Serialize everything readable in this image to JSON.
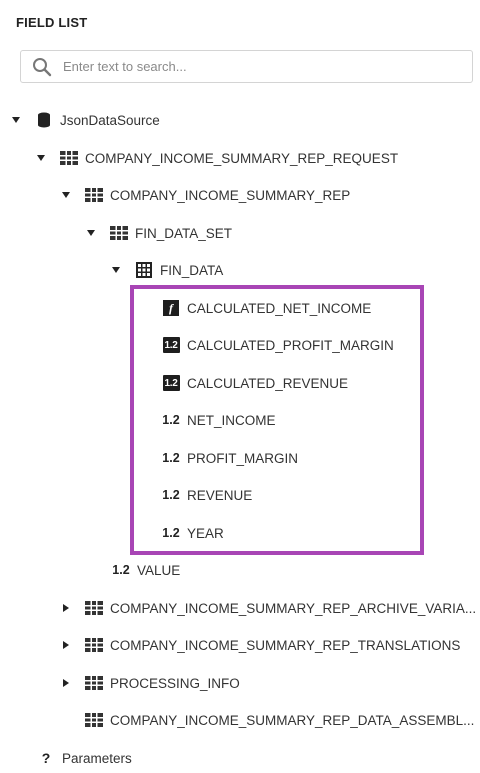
{
  "panel": {
    "title": "FIELD LIST"
  },
  "search": {
    "placeholder": "Enter text to search..."
  },
  "colors": {
    "highlight": "#a845b5",
    "icon_dark": "#1e1e1e"
  },
  "tree": {
    "datasource": {
      "label": "JsonDataSource",
      "icon": "database-icon"
    },
    "request": {
      "label": "COMPANY_INCOME_SUMMARY_REP_REQUEST",
      "icon": "table-icon"
    },
    "rep": {
      "label": "COMPANY_INCOME_SUMMARY_REP",
      "icon": "table-icon"
    },
    "fin_data_set": {
      "label": "FIN_DATA_SET",
      "icon": "table-icon"
    },
    "fin_data": {
      "label": "FIN_DATA",
      "icon": "grid-icon"
    },
    "fields": [
      {
        "label": "CALCULATED_NET_INCOME",
        "icon": "function-icon",
        "badge": "f"
      },
      {
        "label": "CALCULATED_PROFIT_MARGIN",
        "icon": "calculated-number-icon",
        "badge": "1.2"
      },
      {
        "label": "CALCULATED_REVENUE",
        "icon": "calculated-number-icon",
        "badge": "1.2"
      },
      {
        "label": "NET_INCOME",
        "icon": "number-icon",
        "badge": "1.2"
      },
      {
        "label": "PROFIT_MARGIN",
        "icon": "number-icon",
        "badge": "1.2"
      },
      {
        "label": "REVENUE",
        "icon": "number-icon",
        "badge": "1.2"
      },
      {
        "label": "YEAR",
        "icon": "number-icon",
        "badge": "1.2"
      }
    ],
    "value": {
      "label": "VALUE",
      "icon": "number-icon",
      "badge": "1.2"
    },
    "archive": {
      "label": "COMPANY_INCOME_SUMMARY_REP_ARCHIVE_VARIA...",
      "icon": "table-icon"
    },
    "translations": {
      "label": "COMPANY_INCOME_SUMMARY_REP_TRANSLATIONS",
      "icon": "table-icon"
    },
    "processing": {
      "label": "PROCESSING_INFO",
      "icon": "table-icon"
    },
    "assembly": {
      "label": "COMPANY_INCOME_SUMMARY_REP_DATA_ASSEMBL...",
      "icon": "table-icon"
    },
    "parameters": {
      "label": "Parameters",
      "icon": "question-icon",
      "badge": "?"
    }
  }
}
